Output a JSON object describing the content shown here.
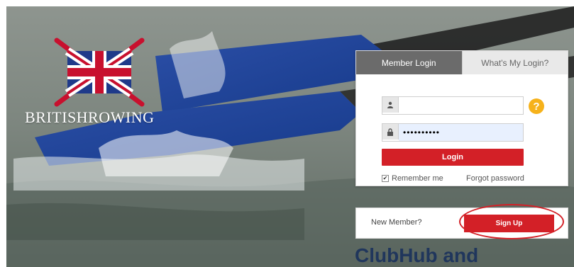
{
  "brand": {
    "name": "BRITISHROWING"
  },
  "login": {
    "tab_active": "Member Login",
    "tab_inactive": "What's My Login?",
    "username_value": "",
    "password_value": "••••••••••",
    "help_label": "?",
    "login_button": "Login",
    "remember_checked": true,
    "remember_label": "Remember me",
    "forgot_label": "Forgot password"
  },
  "signup": {
    "new_member_label": "New Member?",
    "signup_button": "Sign Up"
  },
  "heading": {
    "partial": "ClubHub and"
  },
  "icons": [
    "user-icon",
    "lock-icon",
    "help-icon",
    "check-icon"
  ],
  "colors": {
    "accent_red": "#d32027",
    "help_yellow": "#f6b21b",
    "tab_active": "#6b6b6b",
    "heading_navy": "#20365c"
  }
}
